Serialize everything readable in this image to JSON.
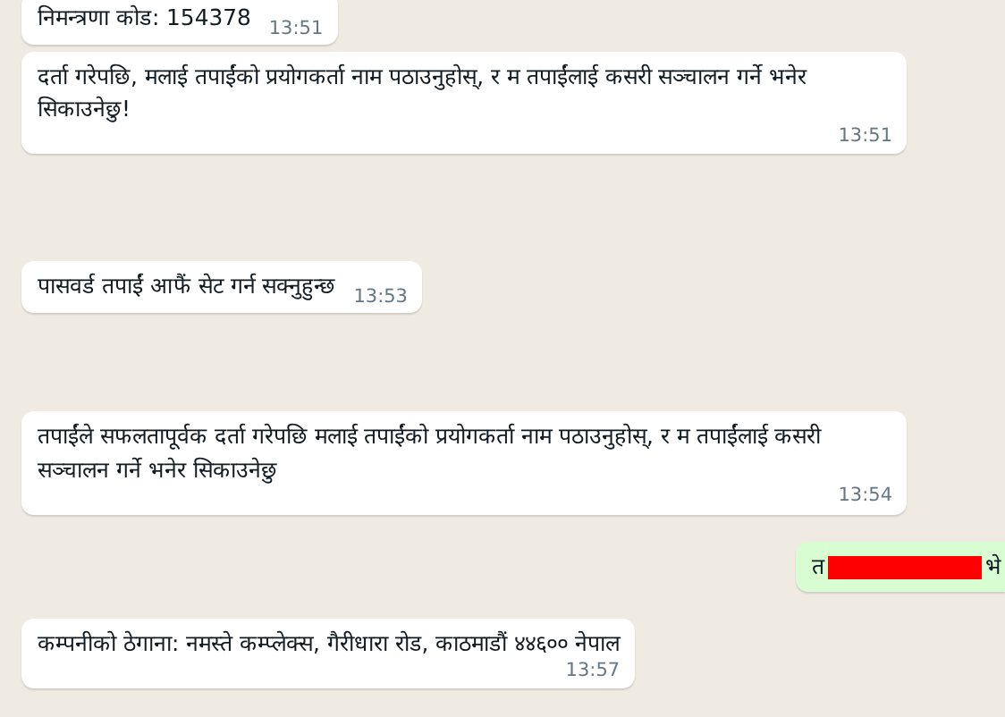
{
  "messages": [
    {
      "kind": "incoming",
      "text": "निमन्त्रणा कोड: 154378",
      "time": "13:51"
    },
    {
      "kind": "incoming",
      "text": "दर्ता गरेपछि, मलाई तपाईंको प्रयोगकर्ता नाम पठाउनुहोस्, र म तपाईंलाई कसरी सञ्चालन गर्ने भनेर सिकाउनेछु!",
      "time": "13:51"
    },
    {
      "kind": "incoming",
      "text": "पासवर्ड तपाईं आफैं सेट गर्न सक्नुहुन्छ",
      "time": "13:53"
    },
    {
      "kind": "incoming",
      "text": "तपाईंले सफलतापूर्वक दर्ता गरेपछि मलाई तपाईंको प्रयोगकर्ता नाम पठाउनुहोस्, र म तपाईंलाई कसरी सञ्चालन गर्ने भनेर सिकाउनेछु",
      "time": "13:54"
    },
    {
      "kind": "outgoing",
      "text_before": "त",
      "redacted": true,
      "text_after": "भे"
    },
    {
      "kind": "incoming",
      "text": "कम्पनीको ठेगाना: नमस्ते कम्प्लेक्स, गैरीधारा रोड, काठमाडौं ४४६०० नेपाल",
      "time": "13:57"
    }
  ]
}
